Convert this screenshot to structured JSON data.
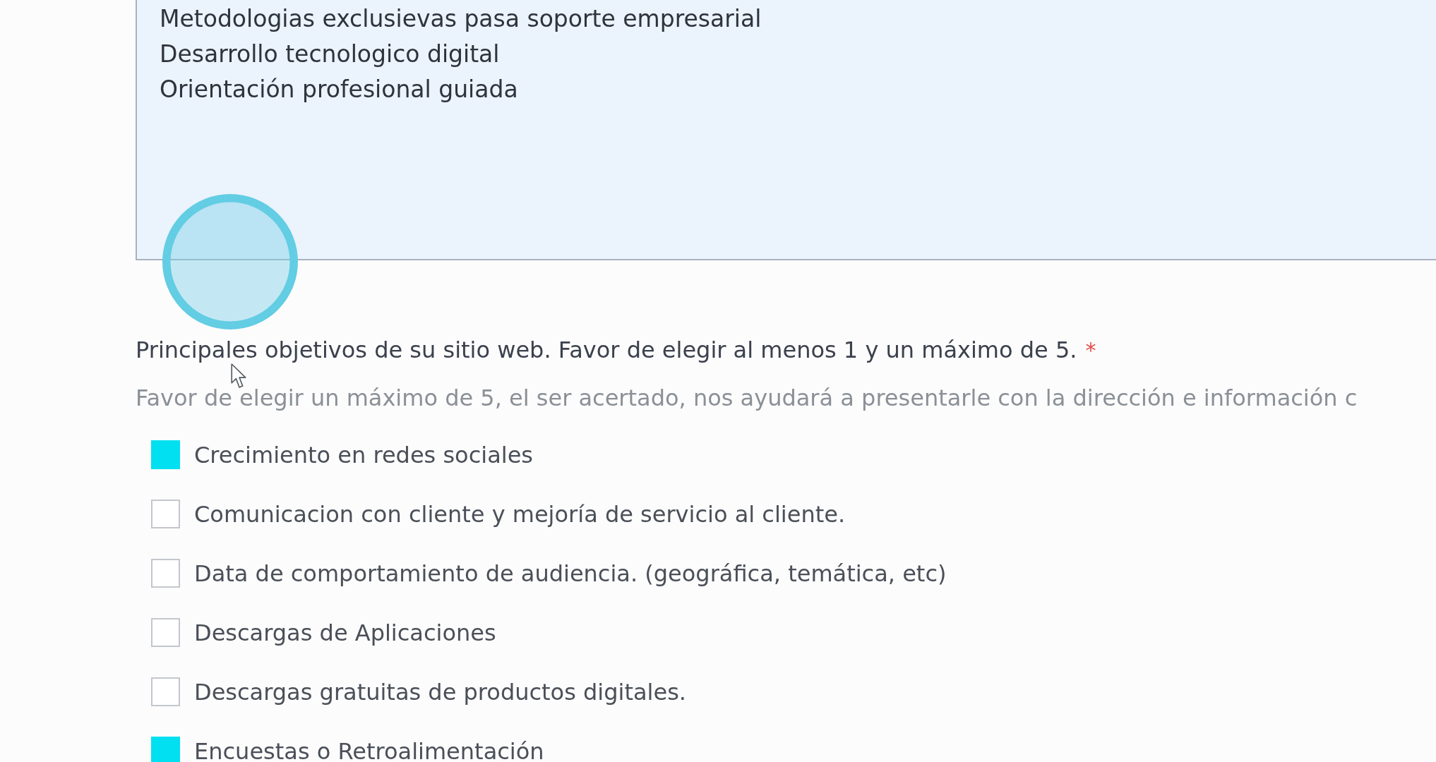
{
  "textarea": {
    "lines": [
      "Metodologias exclusievas pasa soporte empresarial",
      "Desarrollo tecnologico digital",
      "Orientación profesional guiada"
    ]
  },
  "question": {
    "label": "Principales objetivos de su sitio web. Favor de elegir al menos 1 y un máximo de 5.",
    "required_mark": "*",
    "description": "Favor de elegir un máximo de 5, el ser acertado, nos ayudará a presentarle con la dirección e información c",
    "options": [
      {
        "label": "Crecimiento en redes sociales",
        "checked": true
      },
      {
        "label": "Comunicacion con cliente y mejoría de servicio al cliente.",
        "checked": false
      },
      {
        "label": "Data de comportamiento de audiencia. (geográfica, temática, etc)",
        "checked": false
      },
      {
        "label": "Descargas de Aplicaciones",
        "checked": false
      },
      {
        "label": "Descargas gratuitas de productos digitales.",
        "checked": false
      },
      {
        "label": "Encuestas o Retroalimentación",
        "checked": true
      }
    ]
  }
}
